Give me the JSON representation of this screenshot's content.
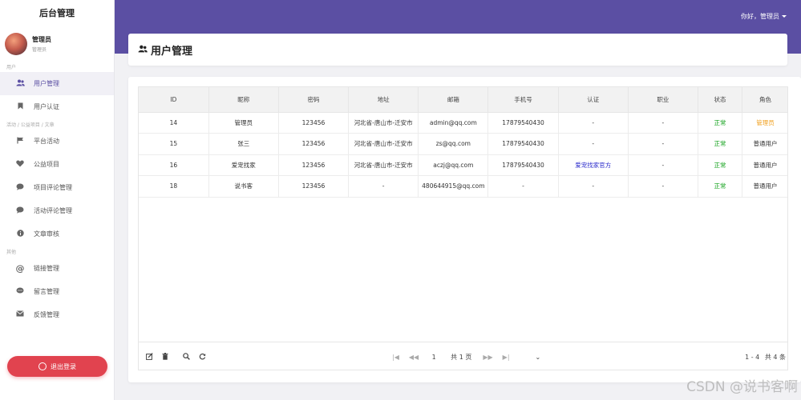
{
  "brand": "后台管理",
  "profile": {
    "name": "管理员",
    "role": "管理员"
  },
  "sidebar": {
    "section1": "用户",
    "items1": [
      {
        "label": "用户管理",
        "icon": "users-icon"
      },
      {
        "label": "用户认证",
        "icon": "bookmark-icon"
      }
    ],
    "section2": "活动 / 公益项目 / 文章",
    "items2": [
      {
        "label": "平台活动",
        "icon": "flag-icon"
      },
      {
        "label": "公益项目",
        "icon": "heart-icon"
      },
      {
        "label": "项目评论管理",
        "icon": "comment-icon"
      },
      {
        "label": "活动评论管理",
        "icon": "comment-icon"
      },
      {
        "label": "文章审核",
        "icon": "info-icon"
      }
    ],
    "section3": "其他",
    "items3": [
      {
        "label": "链接管理",
        "icon": "at-icon"
      },
      {
        "label": "留言管理",
        "icon": "message-icon"
      },
      {
        "label": "反馈管理",
        "icon": "envelope-icon"
      }
    ],
    "logout_label": "退出登录"
  },
  "header": {
    "greeting": "你好，管理员"
  },
  "page": {
    "title": "用户管理"
  },
  "table": {
    "columns": [
      "ID",
      "昵称",
      "密码",
      "地址",
      "邮箱",
      "手机号",
      "认证",
      "职业",
      "状态",
      "角色"
    ],
    "rows": [
      [
        "14",
        "管理员",
        "123456",
        "河北省-唐山市-迁安市",
        "admin@qq.com",
        "17879540430",
        "-",
        "-",
        "正常",
        "管理员"
      ],
      [
        "15",
        "张三",
        "123456",
        "河北省-唐山市-迁安市",
        "zs@qq.com",
        "17879540430",
        "-",
        "-",
        "正常",
        "普通用户"
      ],
      [
        "16",
        "爱宠找家",
        "123456",
        "河北省-唐山市-迁安市",
        "aczj@qq.com",
        "17879540430",
        "爱宠找家官方",
        "-",
        "正常",
        "普通用户"
      ],
      [
        "18",
        "说书客",
        "123456",
        "-",
        "480644915@qq.com",
        "-",
        "-",
        "-",
        "正常",
        "普通用户"
      ]
    ]
  },
  "pagination": {
    "current_page": "1",
    "total_pages": "共 1 页",
    "range": "1 - 4",
    "total": "共 4 条"
  },
  "colors": {
    "primary": "#5b4fa3",
    "danger": "#e1434f",
    "status_ok": "#11a11a",
    "role_admin": "#f0a020"
  },
  "watermark": "CSDN @说书客啊"
}
